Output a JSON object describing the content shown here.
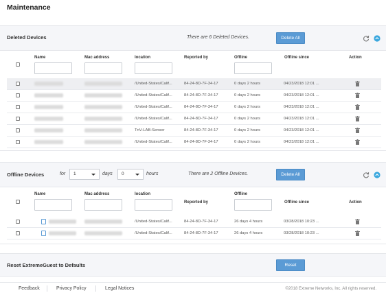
{
  "page": {
    "title": "Maintenance"
  },
  "deleted": {
    "title": "Deleted Devices",
    "message": "There are 6 Deleted Devices.",
    "delete_all": "Delete All",
    "columns": {
      "name": "Name",
      "mac": "Mac address",
      "location": "location",
      "reported_by": "Reported by",
      "offline": "Offline",
      "offline_since": "Offline since",
      "action": "Action"
    },
    "rows": [
      {
        "location": "/United-States/Calif...",
        "reported_by": "84-24-8D-7F-34-17",
        "offline": "0 days 2 hours",
        "offline_since": "04/23/2018 12:01 ..."
      },
      {
        "location": "/United-States/Calif...",
        "reported_by": "84-24-8D-7F-34-17",
        "offline": "0 days 2 hours",
        "offline_since": "04/23/2018 12:01 ..."
      },
      {
        "location": "/United-States/Calif...",
        "reported_by": "84-24-8D-7F-34-17",
        "offline": "0 days 2 hours",
        "offline_since": "04/23/2018 12:01 ..."
      },
      {
        "location": "/United-States/Calif...",
        "reported_by": "84-24-8D-7F-34-17",
        "offline": "0 days 2 hours",
        "offline_since": "04/23/2018 12:01 ..."
      },
      {
        "location": "TnV-LAB-Sensor",
        "reported_by": "84-24-8D-7F-34-17",
        "offline": "0 days 2 hours",
        "offline_since": "04/23/2018 12:01 ..."
      },
      {
        "location": "/United-States/Calif...",
        "reported_by": "84-24-8D-7F-34-17",
        "offline": "0 days 2 hours",
        "offline_since": "04/23/2018 12:01 ..."
      }
    ]
  },
  "offline": {
    "title": "Offline Devices",
    "for_label": "for",
    "days_value": "1",
    "days_label": "days",
    "hours_value": "0",
    "hours_label": "hours",
    "message": "There are 2 Offline Devices.",
    "delete_all": "Delete All",
    "columns": {
      "name": "Name",
      "mac": "Mac address",
      "location": "location",
      "reported_by": "Reported by",
      "offline": "Offline",
      "offline_since": "Offline since",
      "action": "Action"
    },
    "rows": [
      {
        "location": "/United-States/Calif...",
        "reported_by": "84-24-8D-7F-34-17",
        "offline": "26 days 4 hours",
        "offline_since": "03/28/2018 10:23 ..."
      },
      {
        "location": "/United-States/Calif...",
        "reported_by": "84-24-8D-7F-34-17",
        "offline": "26 days 4 hours",
        "offline_since": "03/28/2018 10:23 ..."
      }
    ]
  },
  "reset": {
    "title": "Reset ExtremeGuest to Defaults",
    "button": "Reset"
  },
  "footer": {
    "feedback": "Feedback",
    "privacy": "Privacy Policy",
    "legal": "Legal Notices",
    "copyright": "©2018 Extreme Networks, Inc. All rights reserved."
  },
  "colors": {
    "accent": "#5b9bd5",
    "panel_bg": "#f5f6f9"
  }
}
